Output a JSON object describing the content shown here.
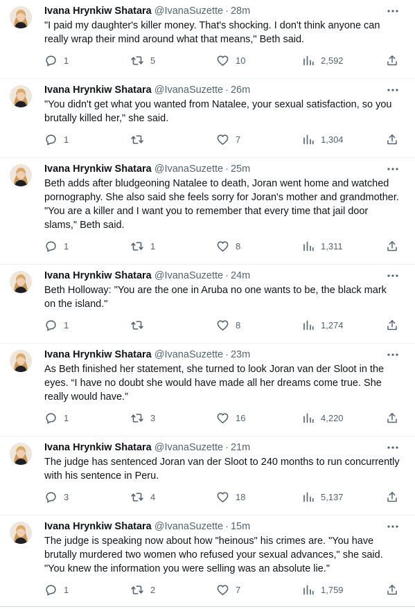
{
  "author": {
    "name": "Ivana Hrynkiw Shatara",
    "handle": "@IvanaSuzette"
  },
  "icons": {
    "reply": "reply-icon",
    "retweet": "retweet-icon",
    "like": "heart-icon",
    "views": "views-chart-icon",
    "share": "share-icon",
    "more": "more-icon"
  },
  "colors": {
    "text_primary": "#0f1419",
    "text_secondary": "#536471",
    "divider": "#eff3f4"
  },
  "tweets": [
    {
      "time": "28m",
      "text": "\"I paid my daughter's killer money. That's shocking. I don't think anyone can really wrap their mind around what that means,\" Beth said.",
      "replies": "1",
      "retweets": "5",
      "likes": "10",
      "views": "2,592"
    },
    {
      "time": "26m",
      "text": "\"You didn't get what you wanted from Natalee, your sexual satisfaction, so you brutally killed her,\" she said.",
      "replies": "1",
      "retweets": "",
      "likes": "7",
      "views": "1,304"
    },
    {
      "time": "25m",
      "text": "Beth adds after bludgeoning Natalee to death, Joran went home and watched pornography. She also said she feels sorry for Joran's mother and grandmother. \"You are a killer and I want you to remember that every time that jail door slams,\" Beth said.",
      "replies": "1",
      "retweets": "1",
      "likes": "8",
      "views": "1,311"
    },
    {
      "time": "24m",
      "text": "Beth Holloway: \"You are the one in Aruba no one wants to be, the black mark on the island.\"",
      "replies": "1",
      "retweets": "",
      "likes": "8",
      "views": "1,274"
    },
    {
      "time": "23m",
      "text": "As Beth finished her statement, she turned to look Joran van der Sloot in the eyes. “I have no doubt she would have made all her dreams come true. She really would have.”",
      "replies": "1",
      "retweets": "3",
      "likes": "16",
      "views": "4,220"
    },
    {
      "time": "21m",
      "text": "The judge has sentenced Joran van der Sloot to 240 months to run concurrently with his sentence in Peru.",
      "replies": "3",
      "retweets": "4",
      "likes": "18",
      "views": "5,137"
    },
    {
      "time": "15m",
      "text": "The judge is speaking now about how \"heinous\" his crimes are. \"You have brutally murdered two women who refused your sexual advances,\" she said. \"You knew the information you were selling was an absolute lie.\"",
      "replies": "1",
      "retweets": "2",
      "likes": "7",
      "views": "1,759"
    }
  ]
}
